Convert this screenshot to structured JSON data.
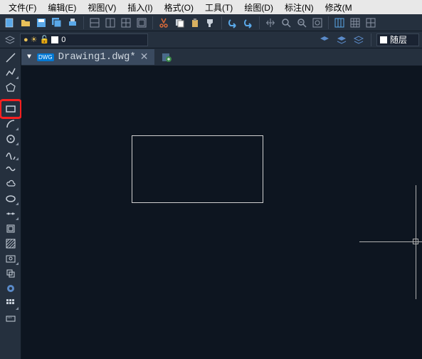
{
  "menubar": {
    "items": [
      "文件(F)",
      "编辑(E)",
      "视图(V)",
      "插入(I)",
      "格式(O)",
      "工具(T)",
      "绘图(D)",
      "标注(N)",
      "修改(M"
    ]
  },
  "toolbar1": {
    "icons": [
      "new-file",
      "open-file",
      "save-file",
      "save-all",
      "print",
      "sep",
      "window-1",
      "window-2",
      "window-3",
      "window-4",
      "sep",
      "cut",
      "copy",
      "paste",
      "format-painter",
      "sep",
      "undo",
      "redo",
      "sep",
      "pan",
      "zoom-window",
      "zoom-extents",
      "zoom-realtime",
      "sep",
      "grid-1",
      "grid-2",
      "grid-3"
    ]
  },
  "toolbar2": {
    "layer_tools_icon": "layer-tools",
    "layer_dropdown": {
      "bulb": "bulb-icon",
      "sun": "sun-icon",
      "lock": "lock-icon",
      "color_swatch": "#ffffff",
      "value": "0"
    },
    "layer_buttons": [
      "layer-prev",
      "layer-match",
      "layer-iso"
    ],
    "color_swatch": "#ffffff",
    "bylayer_label": "随层"
  },
  "tabs": {
    "active": {
      "label": "Drawing1.dwg*",
      "badge": "DWG"
    }
  },
  "left_toolbar": {
    "items": [
      "line",
      "polyline",
      "polygon",
      "sep1",
      "rectangle",
      "arc",
      "circle",
      "spline",
      "wave",
      "revision-cloud",
      "ellipse",
      "point-divider",
      "block-insert",
      "hatch-create",
      "snapshot",
      "region",
      "donut",
      "hatch-pattern",
      "keyboard"
    ],
    "highlighted_index": 4
  },
  "canvas": {
    "shape": "rectangle",
    "theme": "dark"
  }
}
